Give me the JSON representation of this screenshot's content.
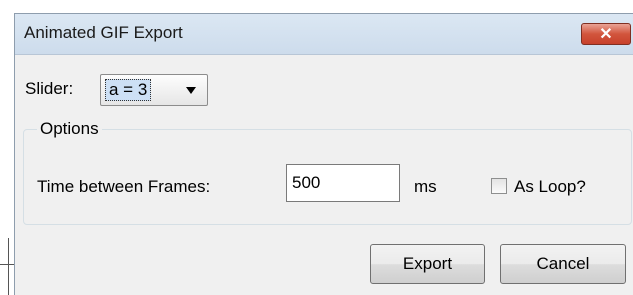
{
  "window": {
    "title": "Animated GIF Export",
    "close_glyph": "✕"
  },
  "slider": {
    "label": "Slider:",
    "selected_value": "a = 3"
  },
  "options": {
    "legend": "Options",
    "time_label": "Time between Frames:",
    "time_value": "500",
    "unit": "ms",
    "loop_label": "As Loop?",
    "loop_checked": false
  },
  "buttons": {
    "export_label": "Export",
    "cancel_label": "Cancel"
  },
  "colors": {
    "close_button": "#d2553d",
    "titlebar": "#dbe7f3",
    "dialog_bg": "#f0f0f0",
    "selection_highlight": "#cde0f5"
  },
  "icons": {
    "close": "close-icon",
    "dropdown": "chevron-down-icon"
  }
}
